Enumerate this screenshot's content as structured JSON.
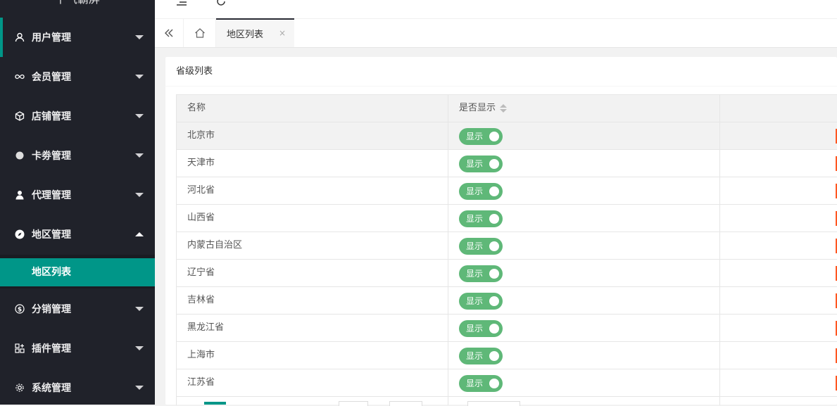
{
  "sidebar": {
    "logo": "千气霸屏",
    "menu": [
      {
        "label": "用户管理",
        "icon": "user-icon"
      },
      {
        "label": "会员管理",
        "icon": "infinity-icon"
      },
      {
        "label": "店铺管理",
        "icon": "cube-icon"
      },
      {
        "label": "卡劵管理",
        "icon": "circle-icon"
      },
      {
        "label": "代理管理",
        "icon": "person-icon"
      },
      {
        "label": "地区管理",
        "icon": "compass-icon"
      },
      {
        "label": "分销管理",
        "icon": "dollar-icon"
      },
      {
        "label": "插件管理",
        "icon": "apps-icon"
      },
      {
        "label": "系统管理",
        "icon": "gear-icon"
      }
    ],
    "submenu": {
      "label": "地区列表"
    }
  },
  "tabs": {
    "active": {
      "label": "地区列表",
      "close": "×"
    }
  },
  "card": {
    "title": "省级列表",
    "table": {
      "headers": {
        "name": "名称",
        "show": "是否显示"
      },
      "switch_label": "显示",
      "rows": [
        {
          "name": "北京市",
          "show": true
        },
        {
          "name": "天津市",
          "show": true
        },
        {
          "name": "河北省",
          "show": true
        },
        {
          "name": "山西省",
          "show": true
        },
        {
          "name": "内蒙古自治区",
          "show": true
        },
        {
          "name": "辽宁省",
          "show": true
        },
        {
          "name": "吉林省",
          "show": true
        },
        {
          "name": "黑龙江省",
          "show": true
        },
        {
          "name": "上海市",
          "show": true
        },
        {
          "name": "江苏省",
          "show": true
        }
      ]
    }
  },
  "colors": {
    "sidebar_bg": "#20222a",
    "accent": "#009688",
    "switch_on": "#5fb878",
    "op_button": "#ff5722"
  }
}
